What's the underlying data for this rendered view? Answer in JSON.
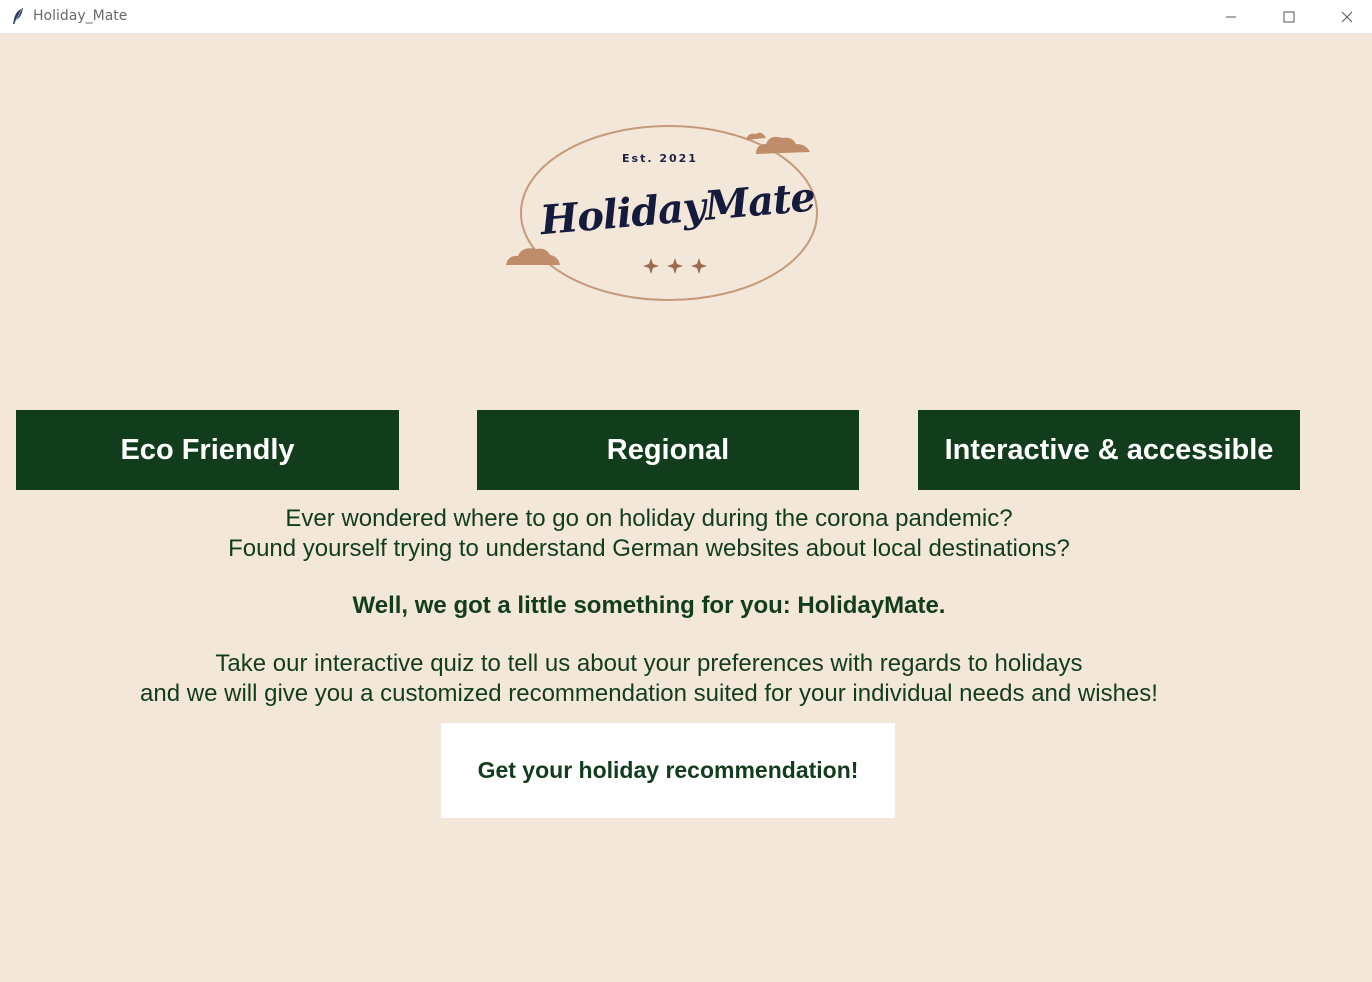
{
  "window": {
    "title": "Holiday_Mate",
    "controls": [
      "minimize",
      "maximize",
      "close"
    ]
  },
  "logo": {
    "established": "Est. 2021",
    "brand": "HolidayMate"
  },
  "features": {
    "eco": "Eco Friendly",
    "regional": "Regional",
    "interactive": "Interactive & accessible"
  },
  "intro": {
    "line1": "Ever wondered where to go on holiday during the corona pandemic?",
    "line2": "Found yourself trying to understand German websites about local destinations?",
    "tagline": "Well, we got a little something for you: HolidayMate.",
    "line3": "Take our interactive quiz to tell us about your preferences with regards to holidays",
    "line4": "and we will give you a customized recommendation suited for your individual needs and wishes!"
  },
  "cta": {
    "label": "Get your holiday recommendation!"
  },
  "colors": {
    "background": "#f3e7d9",
    "primary_green": "#123d1d",
    "logo_copper": "#c08d6a",
    "logo_navy": "#151b3d"
  }
}
